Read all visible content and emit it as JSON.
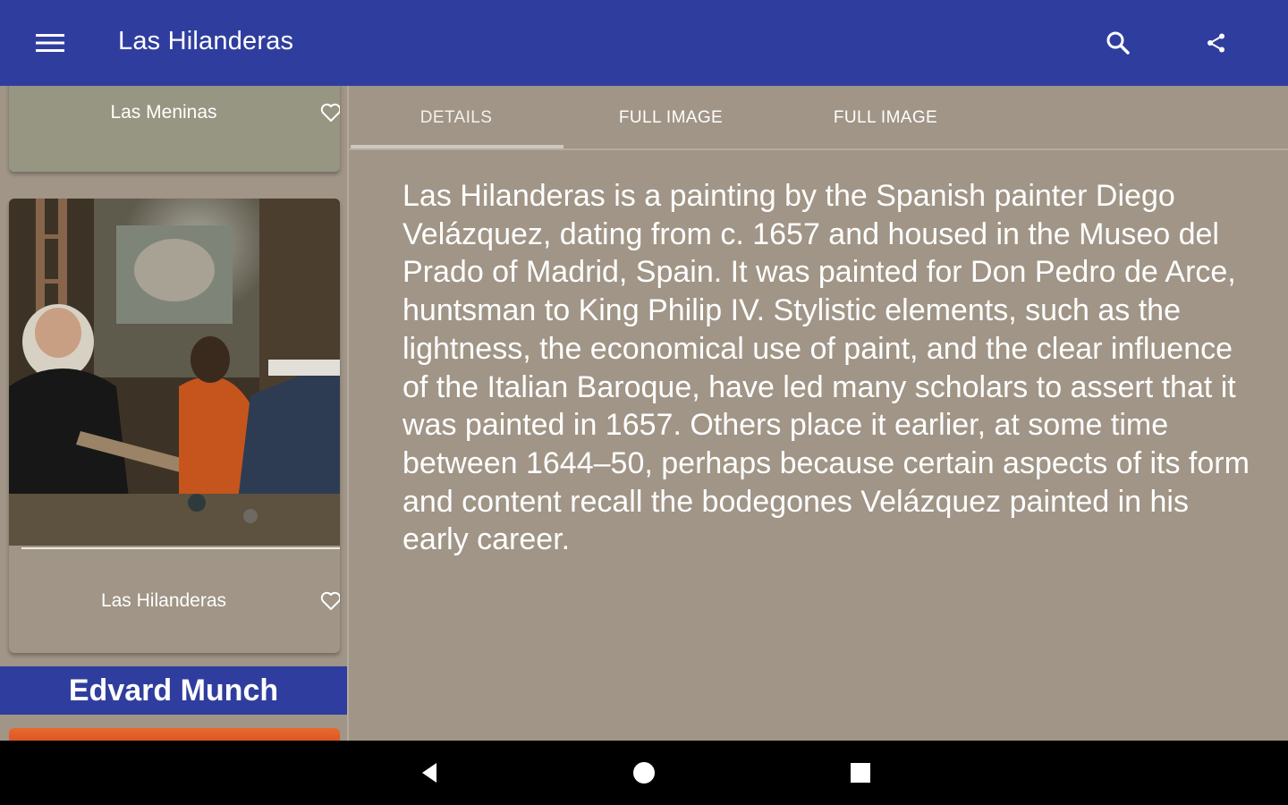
{
  "appbar": {
    "title": "Las Hilanderas",
    "menu_icon": "menu-icon",
    "search_icon": "search-icon",
    "share_icon": "share-icon",
    "color": "#2f3e9e"
  },
  "gallery": {
    "cards": [
      {
        "title": "Las Meninas",
        "favorite_icon": "heart-outline-icon"
      },
      {
        "title": "Las Hilanderas",
        "favorite_icon": "heart-outline-icon",
        "image": "las-hilanderas-painting"
      }
    ],
    "next_section": {
      "artist": "Edvard Munch"
    }
  },
  "detail": {
    "tabs": [
      {
        "label": "DETAILS",
        "selected": true
      },
      {
        "label": "FULL IMAGE",
        "selected": false
      },
      {
        "label": "FULL IMAGE",
        "selected": false
      }
    ],
    "description": "Las Hilanderas is a painting by the Spanish painter Diego Velázquez, dating from c. 1657 and housed in the Museo del Prado of Madrid, Spain. It was painted for Don Pedro de Arce, huntsman to King Philip IV. Stylistic elements, such as the lightness, the economical use of paint, and the clear influence of the Italian Baroque, have led many scholars to assert that it was painted in 1657. Others place it earlier, at some time between 1644–50, perhaps because certain aspects of its form and content recall the bodegones Velázquez painted in his early career."
  },
  "navbar": {
    "back_icon": "back-icon",
    "home_icon": "home-icon",
    "recents_icon": "recents-icon"
  },
  "colors": {
    "background": "#a09586",
    "appbar": "#2f3e9e",
    "section_header": "#2f3e9e"
  }
}
